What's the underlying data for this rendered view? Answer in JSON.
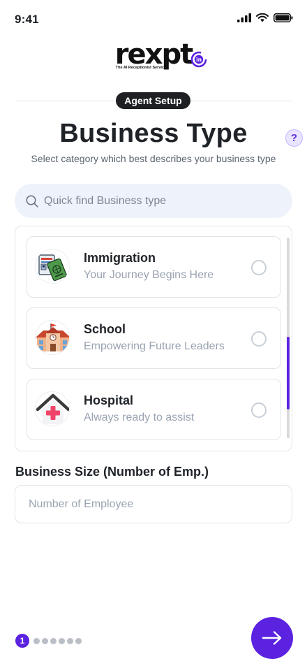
{
  "status_bar": {
    "time": "9:41"
  },
  "brand": {
    "wordmark": "rexpt",
    "tagline": "The AI Receptionist Service",
    "badge_letter": "in"
  },
  "header": {
    "step_pill": "Agent Setup",
    "title": "Business Type",
    "help_glyph": "?",
    "subtitle": "Select category which best describes your business type"
  },
  "search": {
    "placeholder": "Quick find Business type",
    "value": ""
  },
  "business_types": [
    {
      "title": "Immigration",
      "subtitle": "Your Journey Begins Here",
      "icon": "immigration-passport-icon",
      "selected": false
    },
    {
      "title": "School",
      "subtitle": "Empowering Future Leaders",
      "icon": "school-building-icon",
      "selected": false
    },
    {
      "title": "Hospital",
      "subtitle": "Always ready to assist",
      "icon": "hospital-cross-icon",
      "selected": false
    }
  ],
  "business_size": {
    "label": "Business Size (Number of Emp.)",
    "placeholder": "Number of Employee",
    "value": ""
  },
  "pagination": {
    "current": "1",
    "total_steps": 7
  },
  "colors": {
    "accent": "#5B22E0",
    "pill_bg": "#1F2023",
    "search_bg": "#EEF3FB",
    "muted_text": "#9AA3B2"
  }
}
